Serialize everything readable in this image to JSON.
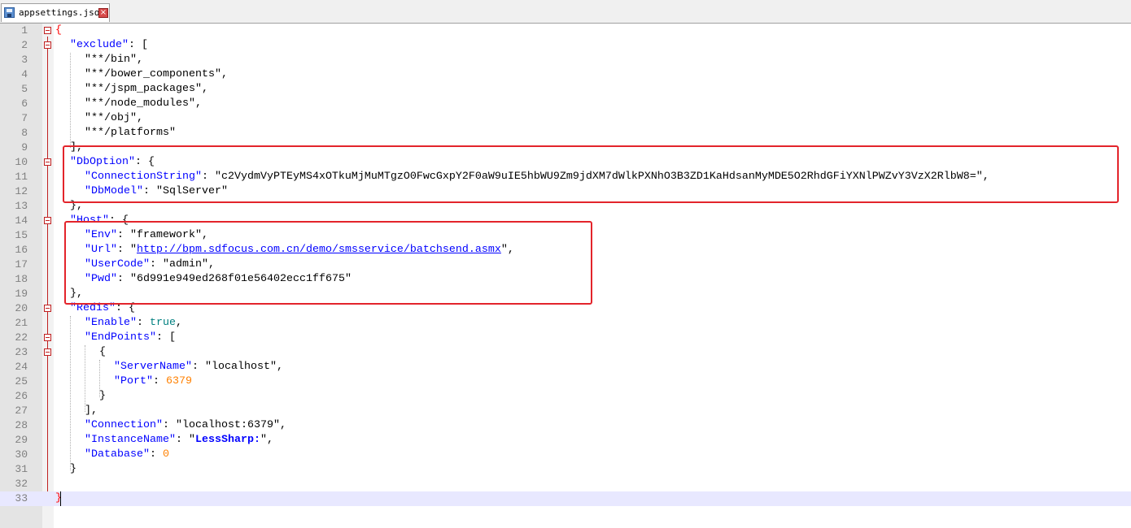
{
  "tab": {
    "filename": "appsettings.json",
    "close_glyph": "×",
    "icon": "save-file-icon"
  },
  "colors": {
    "key": "#0000ff",
    "string": "#000000",
    "bool": "#008080",
    "number": "#ff8000",
    "highlight_box": "#e3242b",
    "current_line": "#e8e8ff"
  },
  "editor": {
    "current_line": 33,
    "line_numbers": [
      "1",
      "2",
      "3",
      "4",
      "5",
      "6",
      "7",
      "8",
      "9",
      "10",
      "11",
      "12",
      "13",
      "14",
      "15",
      "16",
      "17",
      "18",
      "19",
      "20",
      "21",
      "22",
      "23",
      "24",
      "25",
      "26",
      "27",
      "28",
      "29",
      "30",
      "31",
      "32",
      "33"
    ],
    "tokens": {
      "l1_brace": "{",
      "l2_key": "\"exclude\"",
      "l2_rest": ": [",
      "l3": "\"**/bin\",",
      "l4": "\"**/bower_components\",",
      "l5": "\"**/jspm_packages\",",
      "l6": "\"**/node_modules\",",
      "l7": "\"**/obj\",",
      "l8": "\"**/platforms\"",
      "l9": "],",
      "l10_key": "\"DbOption\"",
      "l10_rest": ": {",
      "l11_key": "\"ConnectionString\"",
      "l11_sep": ": ",
      "l11_val": "\"c2VydmVyPTEyMS4xOTkuMjMuMTgzO0FwcGxpY2F0aW9uIE5hbWU9Zm9jdXM7dWlkPXNhO3B3ZD1KaHdsanMyMDE5O2RhdGFiYXNlPWZvY3VzX2RlbW8=\",",
      "l12_key": "\"DbModel\"",
      "l12_sep": ": ",
      "l12_val": "\"SqlServer\"",
      "l13": "},",
      "l14_key": "\"Host\"",
      "l14_rest": ": {",
      "l15_key": "\"Env\"",
      "l15_sep": ": ",
      "l15_val": "\"framework\",",
      "l16_key": "\"Url\"",
      "l16_sep": ": \"",
      "l16_url": "http://bpm.sdfocus.com.cn/demo/smsservice/batchsend.asmx",
      "l16_end": "\",",
      "l17_key": "\"UserCode\"",
      "l17_sep": ": ",
      "l17_val": "\"admin\",",
      "l18_key": "\"Pwd\"",
      "l18_sep": ": ",
      "l18_val": "\"6d991e949ed268f01e56402ecc1ff675\"",
      "l19": "},",
      "l20_key": "\"Redis\"",
      "l20_rest": ": {",
      "l21_key": "\"Enable\"",
      "l21_sep": ": ",
      "l21_val": "true",
      "l21_end": ",",
      "l22_key": "\"EndPoints\"",
      "l22_rest": ": [",
      "l23": "{",
      "l24_key": "\"ServerName\"",
      "l24_sep": ": ",
      "l24_val": "\"localhost\",",
      "l25_key": "\"Port\"",
      "l25_sep": ": ",
      "l25_val": "6379",
      "l26": "}",
      "l27": "],",
      "l28_key": "\"Connection\"",
      "l28_sep": ": ",
      "l28_val": "\"localhost:6379\",",
      "l29_key": "\"InstanceName\"",
      "l29_sep": ": \"",
      "l29_val": "LessSharp:",
      "l29_end": "\",",
      "l30_key": "\"Database\"",
      "l30_sep": ": ",
      "l30_val": "0",
      "l31": "}",
      "l33_brace": "}"
    }
  }
}
